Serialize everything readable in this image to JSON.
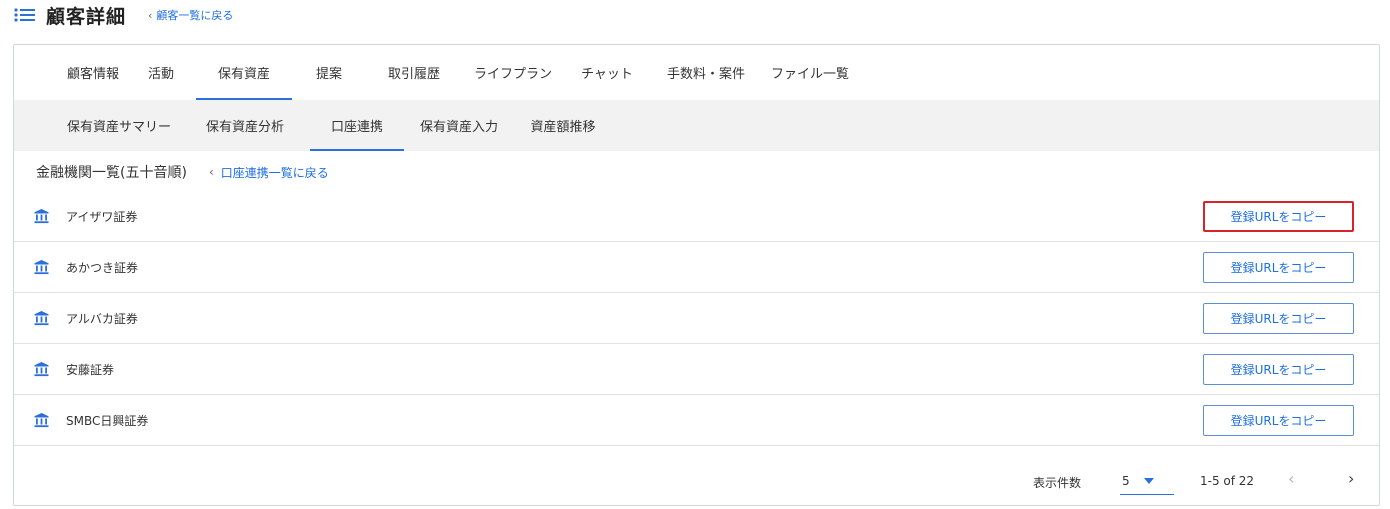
{
  "header": {
    "title": "顧客詳細",
    "back_link": "顧客一覧に戻る",
    "back_chevron": "‹"
  },
  "tabs": [
    {
      "label": "顧客情報",
      "active": false
    },
    {
      "label": "活動",
      "active": false
    },
    {
      "label": "保有資産",
      "active": true
    },
    {
      "label": "提案",
      "active": false
    },
    {
      "label": "取引履歴",
      "active": false
    },
    {
      "label": "ライフプラン",
      "active": false
    },
    {
      "label": "チャット",
      "active": false
    },
    {
      "label": "手数料・案件",
      "active": false
    },
    {
      "label": "ファイル一覧",
      "active": false
    }
  ],
  "subtabs": [
    {
      "label": "保有資産サマリー",
      "active": false
    },
    {
      "label": "保有資産分析",
      "active": false
    },
    {
      "label": "口座連携",
      "active": true
    },
    {
      "label": "保有資産入力",
      "active": false
    },
    {
      "label": "資産額推移",
      "active": false
    }
  ],
  "list": {
    "title": "金融機関一覧(五十音順)",
    "back_link": "口座連携一覧に戻る",
    "back_chevron": "‹"
  },
  "institutions": [
    {
      "name": "アイザワ証券",
      "button": "登録URLをコピー",
      "highlighted": true
    },
    {
      "name": "あかつき証券",
      "button": "登録URLをコピー",
      "highlighted": false
    },
    {
      "name": "アルバカ証券",
      "button": "登録URLをコピー",
      "highlighted": false
    },
    {
      "name": "安藤証券",
      "button": "登録URLをコピー",
      "highlighted": false
    },
    {
      "name": "SMBC日興証券",
      "button": "登録URLをコピー",
      "highlighted": false
    }
  ],
  "pagination": {
    "per_page_label": "表示件数",
    "per_page_value": "5",
    "range": "1-5 of 22",
    "prev": "‹",
    "next": "›"
  },
  "colors": {
    "accent": "#2a6fdb",
    "link": "#1f6fe0",
    "highlight_border": "#d8232a",
    "subtab_bg": "#f2f2f2"
  },
  "icons": {
    "menu": "menu-list-icon",
    "bank": "bank-icon",
    "dropdown": "caret-down-icon"
  }
}
